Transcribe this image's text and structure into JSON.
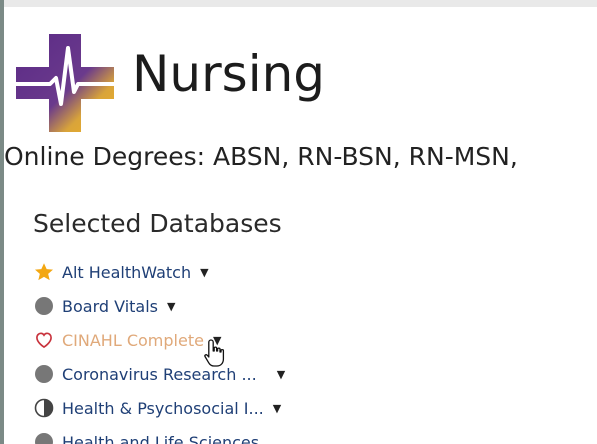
{
  "header": {
    "title": "Nursing",
    "subtitle": "Online Degrees: ABSN, RN-BSN, RN-MSN,"
  },
  "databases": {
    "heading": "Selected Databases",
    "items": [
      {
        "label": "Alt HealthWatch",
        "icon": "star-icon"
      },
      {
        "label": "Board Vitals",
        "icon": "gray-circle-icon"
      },
      {
        "label": "CINAHL Complete",
        "icon": "heart-outline-icon"
      },
      {
        "label": "Coronavirus Research ...",
        "icon": "gray-circle-icon"
      },
      {
        "label": "Health & Psychosocial I...",
        "icon": "half-circle-icon"
      },
      {
        "label": "Health and Life Sciences",
        "icon": "gray-circle-icon"
      }
    ]
  },
  "colors": {
    "link": "#1f3f76",
    "link_hover": "#e0a97a",
    "star": "#f3a712",
    "heart": "#c8323c",
    "circle": "#777777",
    "logo_purple": "#5b2a86",
    "logo_gold": "#f2b321"
  }
}
